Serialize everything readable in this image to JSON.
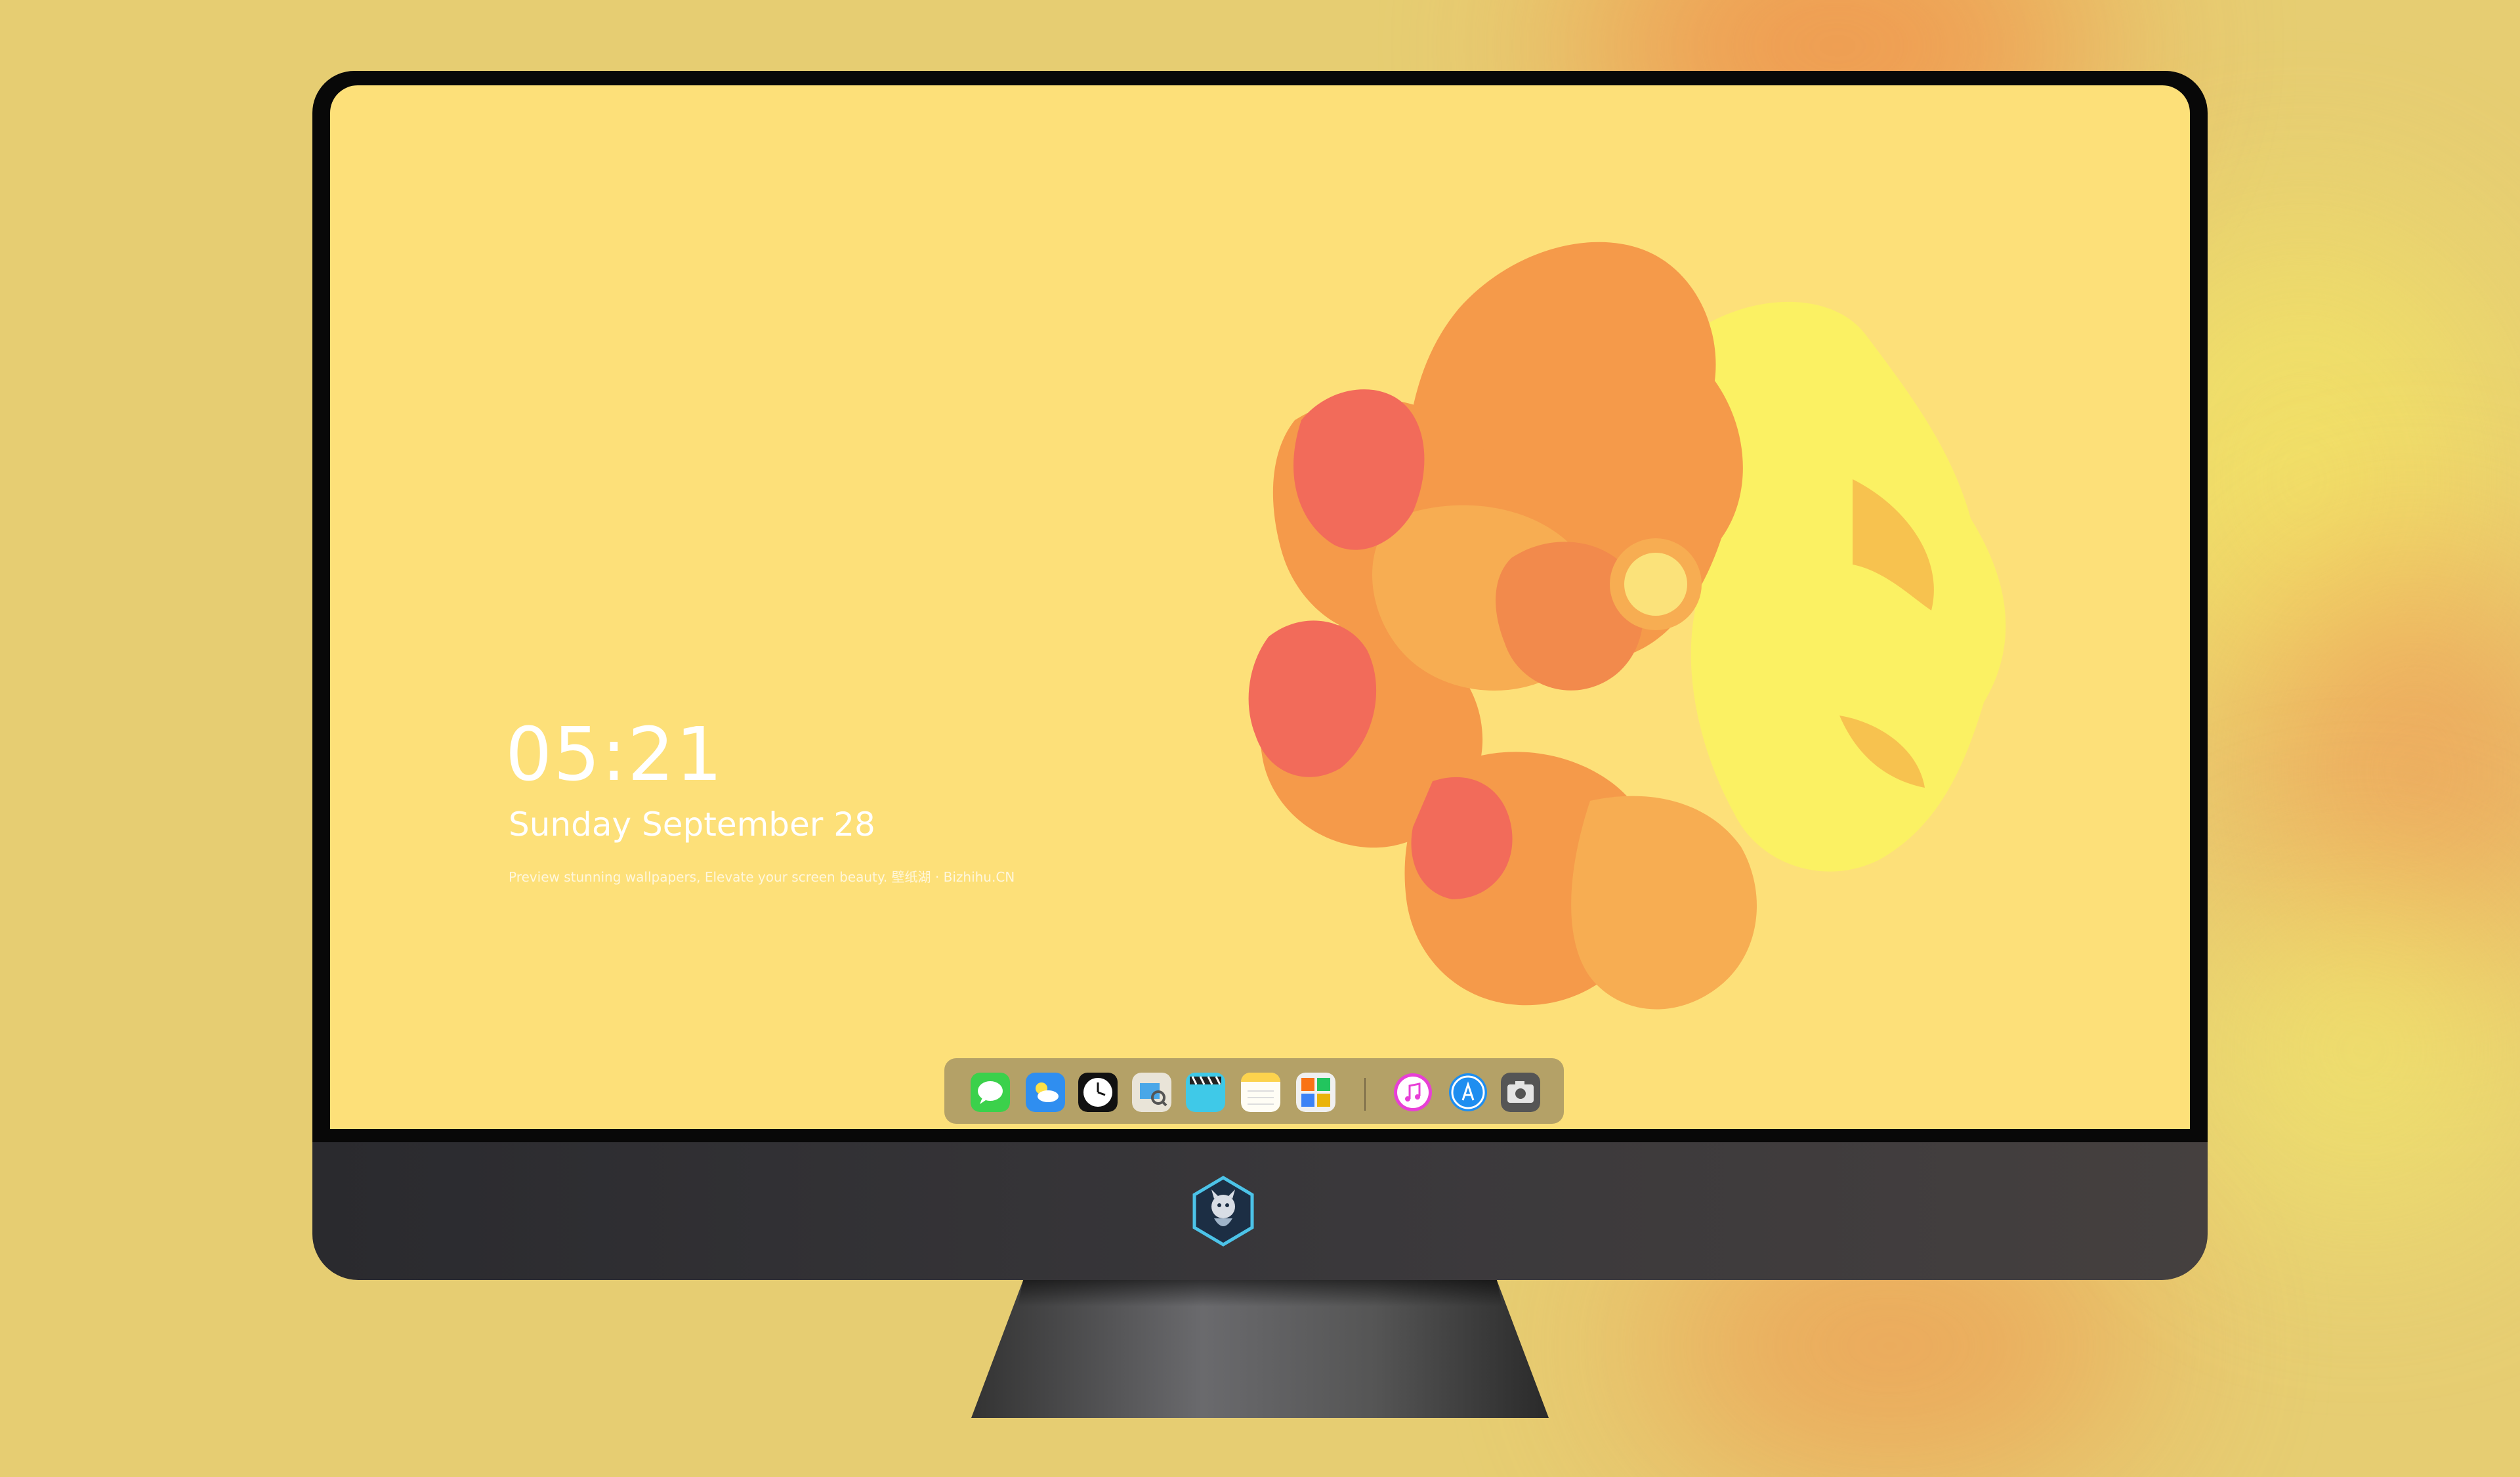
{
  "lock_screen": {
    "time": "05:21",
    "date": "Sunday September  28",
    "tagline": "Preview stunning wallpapers, Elevate your screen beauty. 壁纸湖 · Bizhihu.CN"
  },
  "dock": {
    "apps": [
      {
        "name": "Messages",
        "icon": "messages-icon"
      },
      {
        "name": "Weather",
        "icon": "weather-icon"
      },
      {
        "name": "Clock",
        "icon": "clock-icon"
      },
      {
        "name": "Preview",
        "icon": "preview-icon"
      },
      {
        "name": "Clips",
        "icon": "clips-icon"
      },
      {
        "name": "Notes",
        "icon": "notes-icon"
      },
      {
        "name": "Photo Booth",
        "icon": "photo-booth-icon"
      },
      {
        "name": "Music",
        "icon": "music-icon"
      },
      {
        "name": "App Store",
        "icon": "app-store-icon"
      },
      {
        "name": "Camera",
        "icon": "camera-icon"
      }
    ]
  },
  "colors": {
    "wallpaper": "#fde079",
    "petal_red": "#f26b5a",
    "petal_orange": "#f59a4a",
    "petal_yellow": "#fbf163",
    "chin_dark": "#2a2a2e"
  }
}
